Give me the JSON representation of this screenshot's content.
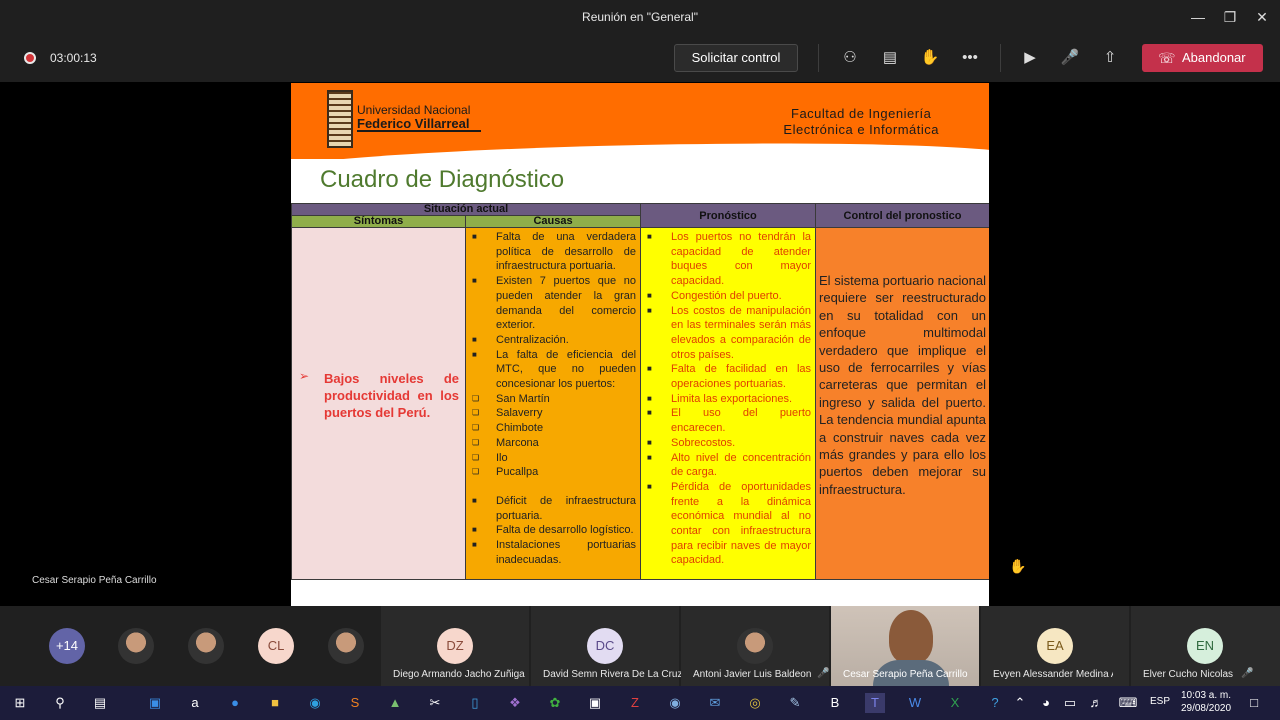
{
  "window": {
    "title": "Reunión en \"General\"",
    "min_icon": "minimize-icon",
    "max_icon": "maximize-icon",
    "close_icon": "close-icon"
  },
  "meeting_bar": {
    "timer": "03:00:13",
    "request_control": "Solicitar control",
    "leave": "Abandonar",
    "leave_color": "#c4314b",
    "icons": [
      "people-icon",
      "chat-icon",
      "raise-hand-icon",
      "more-icon",
      "camera-off-icon",
      "mic-off-icon",
      "share-tray-icon"
    ]
  },
  "slide": {
    "university_line1": "Universidad Nacional",
    "university_line2": "Federico Villarreal",
    "faculty_line1": "Facultad de Ingeniería",
    "faculty_line2": "Electrónica e Informática",
    "title": "Cuadro de Diagnóstico",
    "banner_color": "#ff6d00",
    "table": {
      "header_situacion": "Situación actual",
      "header_sintomas": "Síntomas",
      "header_causas": "Causas",
      "header_pronostico": "Pronóstico",
      "header_control": "Control del pronostico",
      "sintoma": "Bajos niveles de productividad en los puertos del Perú.",
      "causas": [
        {
          "marker": "bullet",
          "text": "Falta de una verdadera política de desarrollo de infraestructura portuaria."
        },
        {
          "marker": "bullet",
          "text": "Existen 7 puertos que no pueden atender la gran demanda del comercio exterior."
        },
        {
          "marker": "bullet",
          "text": "Centralización."
        },
        {
          "marker": "bullet",
          "text": "La falta de eficiencia del MTC, que no pueden concesionar los puertos:"
        },
        {
          "marker": "box",
          "text": "San Martín"
        },
        {
          "marker": "box",
          "text": "Salaverry"
        },
        {
          "marker": "box",
          "text": "Chimbote"
        },
        {
          "marker": "box",
          "text": "Marcona"
        },
        {
          "marker": "box",
          "text": "Ilo"
        },
        {
          "marker": "box",
          "text": "Pucallpa"
        },
        {
          "marker": "bullet",
          "text": "Déficit de infraestructura portuaria.",
          "gap": true
        },
        {
          "marker": "bullet",
          "text": "Falta de desarrollo logístico."
        },
        {
          "marker": "bullet",
          "text": "Instalaciones portuarias inadecuadas."
        }
      ],
      "pronostico": [
        "Los puertos no tendrán la capacidad de atender buques con mayor capacidad.",
        "Congestión del puerto.",
        "Los costos de manipulación en las terminales serán más elevados a comparación de otros países.",
        "Falta de facilidad en las operaciones portuarias.",
        "Limita las exportaciones.",
        "El uso del puerto encarecen.",
        "Sobrecostos.",
        "Alto nivel de concentración de carga.",
        "Pérdida de oportunidades frente a la dinámica económica mundial al no contar con infraestructura para recibir naves de mayor capacidad."
      ],
      "control": "El sistema portuario nacional requiere ser reestructurado en su totalidad con un enfoque multimodal verdadero que implique el uso de ferrocarriles y vías carreteras que permitan el ingreso y salida del puerto. La tendencia mundial apunta a construir naves cada vez más grandes y para ello los puertos deben mejorar su infraestructura."
    }
  },
  "presenter_label": "Cesar Serapio Peña Carrillo",
  "participants": {
    "overflow": "+14",
    "small": [
      {
        "initials": "",
        "kind": "photo"
      },
      {
        "initials": "",
        "kind": "photo"
      },
      {
        "initials": "CL",
        "kind": "initials",
        "color": "#f7d7cc",
        "fg": "#8a4a3a"
      },
      {
        "initials": "",
        "kind": "photo"
      }
    ],
    "tiles": [
      {
        "initials": "DZ",
        "name": "Diego Armando Jacho Zuñiga",
        "color": "#f7d7cc",
        "fg": "#8a4a3a"
      },
      {
        "initials": "DC",
        "name": "David Semn Rivera De La Cruz",
        "color": "#e2dcf2",
        "fg": "#5a4a8a"
      },
      {
        "initials": "",
        "name": "Antoni Javier Luis Baldeon",
        "photo": true
      },
      {
        "initials": "",
        "name": "Cesar Serapio Peña Carrillo",
        "video": true
      },
      {
        "initials": "EA",
        "name": "Evyen Alessander Medina Acosta",
        "color": "#f6e7c2",
        "fg": "#7a5a1a"
      },
      {
        "initials": "EN",
        "name": "Elver Cucho Nicolas",
        "color": "#d6efdc",
        "fg": "#2e6a3e"
      }
    ]
  },
  "taskbar": {
    "lang": "ESP",
    "time": "10:03 a. m.",
    "date": "29/08/2020",
    "icons": [
      "windows-icon",
      "search-icon",
      "task-view-icon",
      "store-icon",
      "amazon-icon",
      "maps-icon",
      "file-explorer-icon",
      "edge-icon",
      "sublime-icon",
      "photos-icon",
      "snip-icon",
      "visual-studio-icon",
      "green-app-icon",
      "terminal-icon",
      "red-app-icon",
      "globe-icon",
      "mail-icon",
      "chrome-icon",
      "tablet-icon",
      "behance-icon",
      "teams-icon",
      "word-icon",
      "excel-icon",
      "help-icon"
    ]
  }
}
